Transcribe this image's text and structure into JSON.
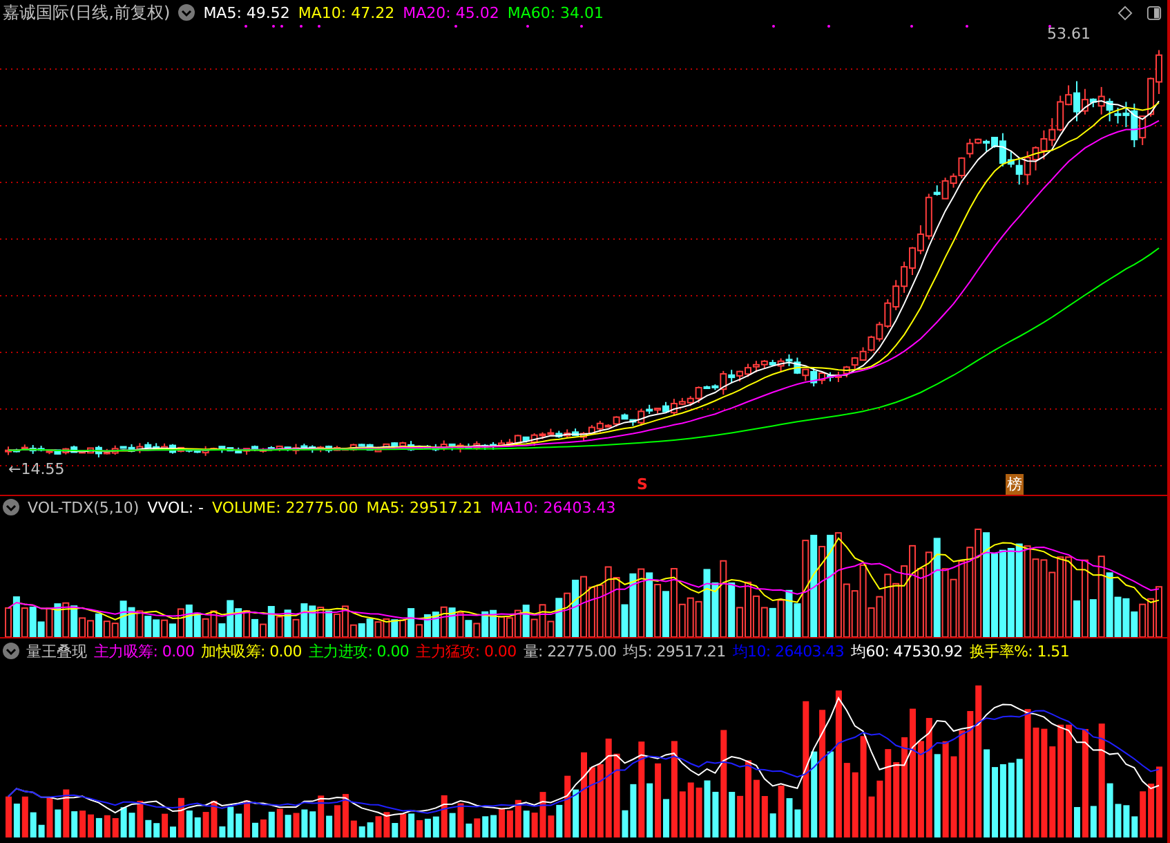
{
  "title": "嘉诚国际(日线,前复权)",
  "ma_legend": [
    {
      "label": "MA5: 49.52",
      "color": "#ffffff"
    },
    {
      "label": "MA10: 47.22",
      "color": "#ffff00"
    },
    {
      "label": "MA20: 45.02",
      "color": "#ff00ff"
    },
    {
      "label": "MA60: 34.01",
      "color": "#00ff00"
    }
  ],
  "high_label": "53.61",
  "low_label": "←14.55",
  "markers": [
    {
      "text": "S",
      "kind": "signal"
    },
    {
      "text": "榜",
      "kind": "badge"
    }
  ],
  "volume_panel": {
    "name": "VOL-TDX(5,10)",
    "legend": [
      {
        "label": "VVOL: -",
        "color": "#ffffff"
      },
      {
        "label": "VOLUME: 22775.00",
        "color": "#ffff00"
      },
      {
        "label": "MA5: 29517.21",
        "color": "#ffff00"
      },
      {
        "label": "MA10: 26403.43",
        "color": "#ff00ff"
      }
    ]
  },
  "indicator_panel": {
    "name": "量王叠现",
    "legend": [
      {
        "label": "主力吸筹: 0.00",
        "color": "#ff00ff"
      },
      {
        "label": "加快吸筹: 0.00",
        "color": "#ffff00"
      },
      {
        "label": "主力进攻: 0.00",
        "color": "#00ff00"
      },
      {
        "label": "主力猛攻: 0.00",
        "color": "#ff0000"
      },
      {
        "label": "量: 22775.00",
        "color": "#c0c0c0"
      },
      {
        "label": "均5: 29517.21",
        "color": "#c0c0c0"
      },
      {
        "label": "均10: 26403.43",
        "color": "#0000ff"
      },
      {
        "label": "均60: 47530.92",
        "color": "#ffffff"
      },
      {
        "label": "换手率%: 1.51",
        "color": "#ffff00"
      }
    ]
  }
}
